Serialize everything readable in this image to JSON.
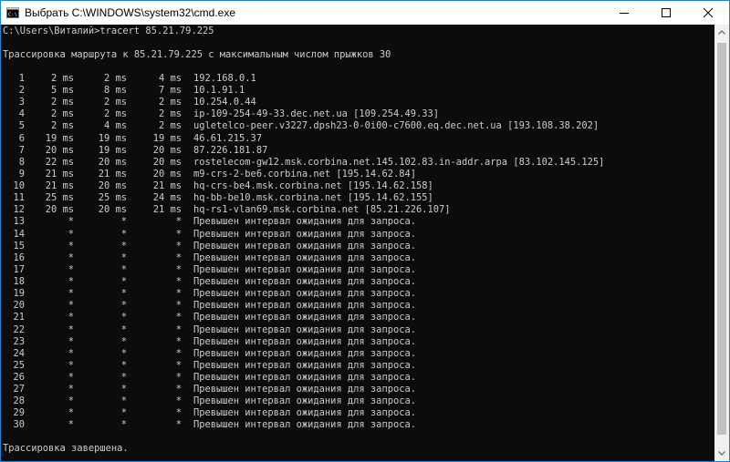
{
  "window": {
    "title": "Выбрать C:\\WINDOWS\\system32\\cmd.exe",
    "controls": [
      "minimize-icon",
      "maximize-icon",
      "close-icon"
    ]
  },
  "console": {
    "prompt": "C:\\Users\\Виталий>tracert 85.21.79.225",
    "header": "Трассировка маршрута к 85.21.79.225 с максимальным числом прыжков 30",
    "hops": [
      {
        "hop": "1",
        "t1": "2 ms",
        "t2": "2 ms",
        "t3": "4 ms",
        "host": "192.168.0.1"
      },
      {
        "hop": "2",
        "t1": "5 ms",
        "t2": "8 ms",
        "t3": "7 ms",
        "host": "10.1.91.1"
      },
      {
        "hop": "3",
        "t1": "2 ms",
        "t2": "2 ms",
        "t3": "2 ms",
        "host": "10.254.0.44"
      },
      {
        "hop": "4",
        "t1": "2 ms",
        "t2": "2 ms",
        "t3": "2 ms",
        "host": "ip-109-254-49-33.dec.net.ua [109.254.49.33]"
      },
      {
        "hop": "5",
        "t1": "2 ms",
        "t2": "4 ms",
        "t3": "2 ms",
        "host": "ugletelco-peer.v3227.dpsh23-0-0i00-c7600.eq.dec.net.ua [193.108.38.202]"
      },
      {
        "hop": "6",
        "t1": "19 ms",
        "t2": "19 ms",
        "t3": "19 ms",
        "host": "46.61.215.37"
      },
      {
        "hop": "7",
        "t1": "20 ms",
        "t2": "19 ms",
        "t3": "20 ms",
        "host": "87.226.181.87"
      },
      {
        "hop": "8",
        "t1": "22 ms",
        "t2": "20 ms",
        "t3": "20 ms",
        "host": "rostelecom-gw12.msk.corbina.net.145.102.83.in-addr.arpa [83.102.145.125]"
      },
      {
        "hop": "9",
        "t1": "21 ms",
        "t2": "21 ms",
        "t3": "20 ms",
        "host": "m9-crs-2-be6.corbina.net [195.14.62.84]"
      },
      {
        "hop": "10",
        "t1": "21 ms",
        "t2": "20 ms",
        "t3": "21 ms",
        "host": "hq-crs-be4.msk.corbina.net [195.14.62.158]"
      },
      {
        "hop": "11",
        "t1": "25 ms",
        "t2": "25 ms",
        "t3": "24 ms",
        "host": "hq-bb-be10.msk.corbina.net [195.14.62.155]"
      },
      {
        "hop": "12",
        "t1": "20 ms",
        "t2": "20 ms",
        "t3": "21 ms",
        "host": "hq-rs1-vlan69.msk.corbina.net [85.21.226.107]"
      },
      {
        "hop": "13",
        "t1": "*",
        "t2": "*",
        "t3": "*",
        "host": "Превышен интервал ожидания для запроса."
      },
      {
        "hop": "14",
        "t1": "*",
        "t2": "*",
        "t3": "*",
        "host": "Превышен интервал ожидания для запроса."
      },
      {
        "hop": "15",
        "t1": "*",
        "t2": "*",
        "t3": "*",
        "host": "Превышен интервал ожидания для запроса."
      },
      {
        "hop": "16",
        "t1": "*",
        "t2": "*",
        "t3": "*",
        "host": "Превышен интервал ожидания для запроса."
      },
      {
        "hop": "17",
        "t1": "*",
        "t2": "*",
        "t3": "*",
        "host": "Превышен интервал ожидания для запроса."
      },
      {
        "hop": "18",
        "t1": "*",
        "t2": "*",
        "t3": "*",
        "host": "Превышен интервал ожидания для запроса."
      },
      {
        "hop": "19",
        "t1": "*",
        "t2": "*",
        "t3": "*",
        "host": "Превышен интервал ожидания для запроса."
      },
      {
        "hop": "20",
        "t1": "*",
        "t2": "*",
        "t3": "*",
        "host": "Превышен интервал ожидания для запроса."
      },
      {
        "hop": "21",
        "t1": "*",
        "t2": "*",
        "t3": "*",
        "host": "Превышен интервал ожидания для запроса."
      },
      {
        "hop": "22",
        "t1": "*",
        "t2": "*",
        "t3": "*",
        "host": "Превышен интервал ожидания для запроса."
      },
      {
        "hop": "23",
        "t1": "*",
        "t2": "*",
        "t3": "*",
        "host": "Превышен интервал ожидания для запроса."
      },
      {
        "hop": "24",
        "t1": "*",
        "t2": "*",
        "t3": "*",
        "host": "Превышен интервал ожидания для запроса."
      },
      {
        "hop": "25",
        "t1": "*",
        "t2": "*",
        "t3": "*",
        "host": "Превышен интервал ожидания для запроса."
      },
      {
        "hop": "26",
        "t1": "*",
        "t2": "*",
        "t3": "*",
        "host": "Превышен интервал ожидания для запроса."
      },
      {
        "hop": "27",
        "t1": "*",
        "t2": "*",
        "t3": "*",
        "host": "Превышен интервал ожидания для запроса."
      },
      {
        "hop": "28",
        "t1": "*",
        "t2": "*",
        "t3": "*",
        "host": "Превышен интервал ожидания для запроса."
      },
      {
        "hop": "29",
        "t1": "*",
        "t2": "*",
        "t3": "*",
        "host": "Превышен интервал ожидания для запроса."
      },
      {
        "hop": "30",
        "t1": "*",
        "t2": "*",
        "t3": "*",
        "host": "Превышен интервал ожидания для запроса."
      }
    ],
    "footer": "Трассировка завершена."
  },
  "colors": {
    "console_bg": "#0c0c0c",
    "console_fg": "#cccccc",
    "titlebar_bg": "#ffffff",
    "window_border": "#1b83d8"
  }
}
